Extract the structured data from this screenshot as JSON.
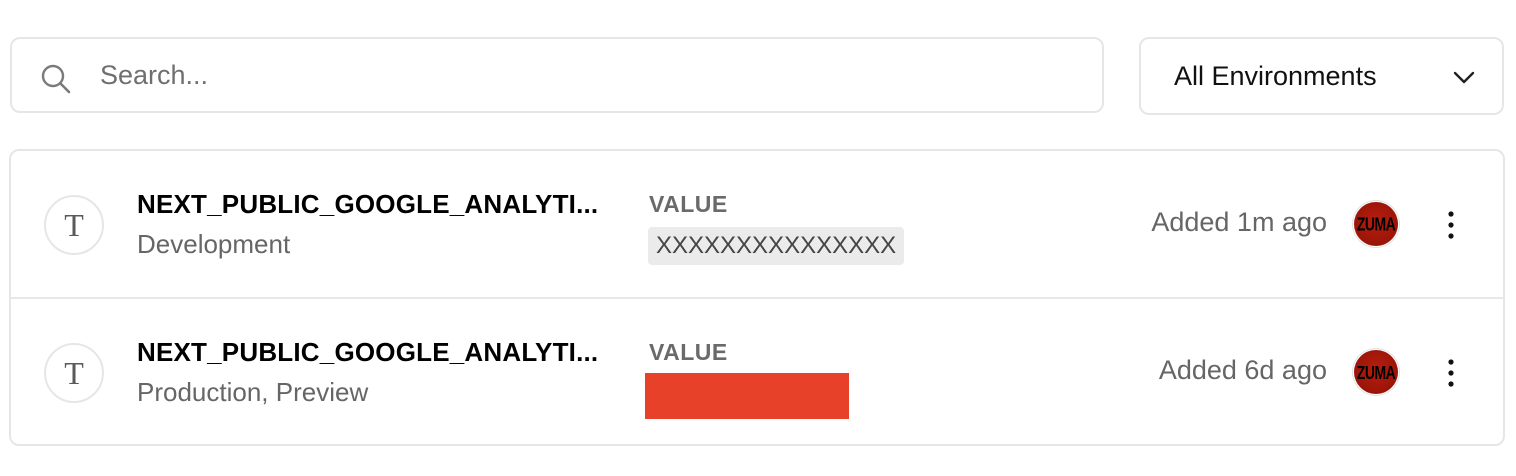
{
  "search": {
    "placeholder": "Search..."
  },
  "environment_filter": {
    "selected": "All Environments"
  },
  "variables": [
    {
      "type_icon": "T",
      "name": "NEXT_PUBLIC_GOOGLE_ANALYTI...",
      "environments": "Development",
      "value_label": "VALUE",
      "value": "XXXXXXXXXXXXXXX",
      "value_redacted": false,
      "added": "Added 1m ago",
      "avatar_text": "ZUMA"
    },
    {
      "type_icon": "T",
      "name": "NEXT_PUBLIC_GOOGLE_ANALYTI...",
      "environments": "Production, Preview",
      "value_label": "VALUE",
      "value_redacted": true,
      "redaction_color": "#e8412a",
      "added": "Added 6d ago",
      "avatar_text": "ZUMA"
    }
  ],
  "colors": {
    "border": "#e6e6e6",
    "muted_text": "#666666",
    "avatar": "#b81e10"
  }
}
